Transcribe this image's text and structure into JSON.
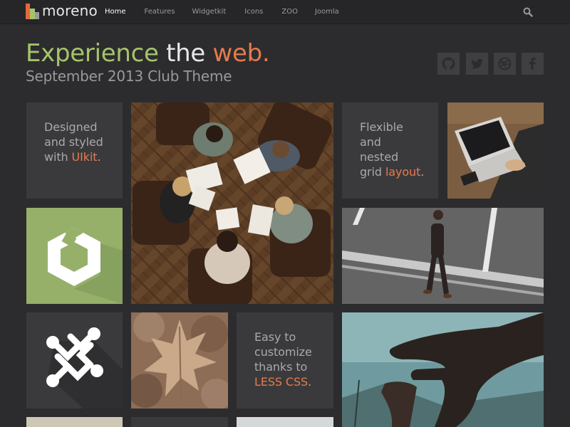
{
  "brand": {
    "name": "moreno"
  },
  "nav": {
    "items": [
      {
        "label": "Home",
        "active": true
      },
      {
        "label": "Features",
        "active": false
      },
      {
        "label": "Widgetkit",
        "active": false
      },
      {
        "label": "Icons",
        "active": false
      },
      {
        "label": "ZOO",
        "active": false
      },
      {
        "label": "Joomla",
        "active": false
      }
    ],
    "search_icon": "search-icon"
  },
  "hero": {
    "headline": {
      "part1": "Experience",
      "part2": "the",
      "part3": "web."
    },
    "subtitle": "September 2013 Club Theme"
  },
  "social": [
    "github-icon",
    "twitter-icon",
    "dribbble-icon",
    "facebook-icon"
  ],
  "tiles": {
    "t1": {
      "line1": "Designed",
      "line2": "and styled",
      "line3_pre": "with ",
      "line3_hl": "UIkit",
      "line3_post": "."
    },
    "t2": {
      "line1": "Flexible",
      "line2": "and",
      "line3": "nested",
      "line4_pre": "grid ",
      "line4_hl": "layout",
      "line4_post": "."
    },
    "t3": {
      "line1": "Easy to",
      "line2": "customize",
      "line3": "thanks to",
      "line4_hl": "LESS CSS",
      "line4_post": "."
    }
  },
  "colors": {
    "background": "#2c2c2e",
    "navbar": "#262628",
    "tile": "#3a3a3c",
    "accent_green": "#a6c46a",
    "accent_orange": "#e67b4d",
    "green_tile": "#96b06a"
  }
}
